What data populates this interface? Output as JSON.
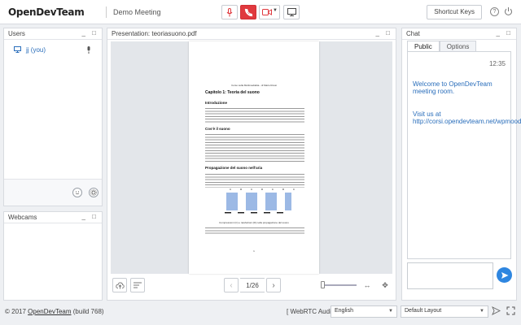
{
  "header": {
    "logo": "OpenDevTeam",
    "meeting_title": "Demo Meeting",
    "shortcut_keys": "Shortcut Keys",
    "help_icon": "?"
  },
  "users": {
    "title": "Users",
    "controls": "_ □",
    "items": [
      {
        "name": "jj (you)"
      }
    ]
  },
  "webcams": {
    "title": "Webcams",
    "controls": "_ □"
  },
  "presentation": {
    "title": "Presentation: teoriasuono.pdf",
    "controls": "_ □",
    "page_indicator": "1/26",
    "document": {
      "header": "Corso sulla Multimedialita - di Mario Rossi",
      "chapter": "Capitolo 1: Teoria del suono",
      "h_intro": "Introduzione",
      "h_what": "Cos'è il suono",
      "h_prop": "Propagazione del suono nell'aria",
      "figure_labels": [
        "C",
        "R",
        "C",
        "R",
        "C",
        "R",
        "C"
      ],
      "caption": "Compressioni (C) e rarefazioni (R) nella propagazione del suono",
      "page_no": "1"
    }
  },
  "chat": {
    "title": "Chat",
    "controls": "_ □",
    "tabs": [
      "Public",
      "Options"
    ],
    "time": "12:35",
    "welcome": "Welcome to OpenDevTeam meeting room.",
    "visit": "Visit us at http://corsi.opendevteam.net/wpmoodle"
  },
  "footer": {
    "copyright": "© 2017",
    "brand_link": "OpenDevTeam",
    "build": "(build 768)",
    "audio": "[ WebRTC Audio ]",
    "language": "English",
    "layout": "Default Layout"
  }
}
